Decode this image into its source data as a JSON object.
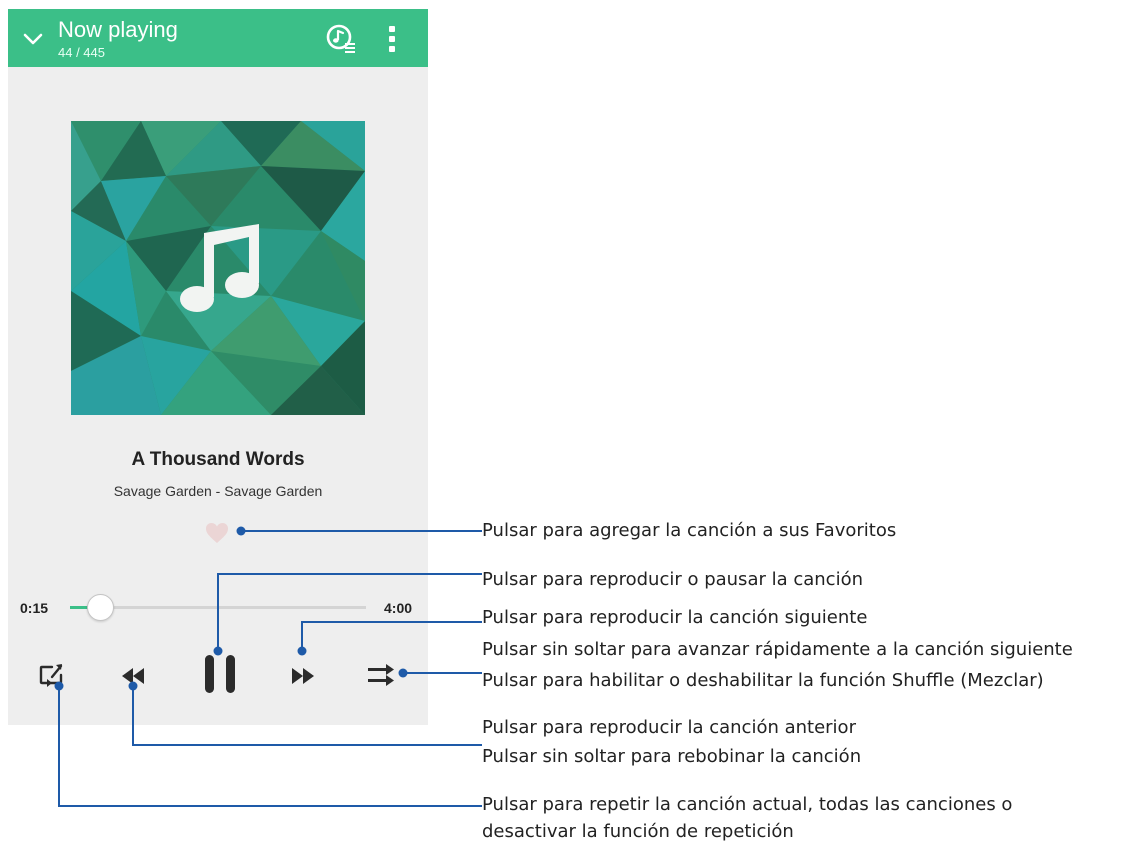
{
  "app_bar": {
    "title": "Now playing",
    "track_count": "44 / 445",
    "background": "#3bbf88",
    "icons": [
      "chevron-down-icon",
      "music-queue-icon",
      "overflow-menu-icon"
    ]
  },
  "track": {
    "title": "A Thousand Words",
    "artist_album": "Savage Garden - Savage Garden",
    "album_art_icon": "music-note-icon"
  },
  "progress": {
    "elapsed": "0:15",
    "total": "4:00",
    "fraction": 0.0625,
    "accent": "#3bbf88"
  },
  "controls": {
    "icons": [
      "repeat-icon",
      "rewind-icon",
      "pause-icon",
      "fast-forward-icon",
      "shuffle-icon"
    ]
  },
  "callouts": {
    "favorite": "Pulsar para agregar la canción a sus Favoritos",
    "play_pause": "Pulsar para reproducir o pausar la canción",
    "next_1": "Pulsar para reproducir la canción siguiente",
    "next_2": "Pulsar sin soltar para avanzar rápidamente a la canción siguiente",
    "shuffle": "Pulsar para habilitar o deshabilitar la función Shuffle (Mezclar)",
    "prev_1": "Pulsar para reproducir la canción anterior",
    "prev_2": "Pulsar sin soltar para rebobinar la canción",
    "repeat_1": "Pulsar para repetir la canción actual, todas las canciones o",
    "repeat_2": "desactivar la función de repetición",
    "line_color": "#1e5aa8"
  }
}
